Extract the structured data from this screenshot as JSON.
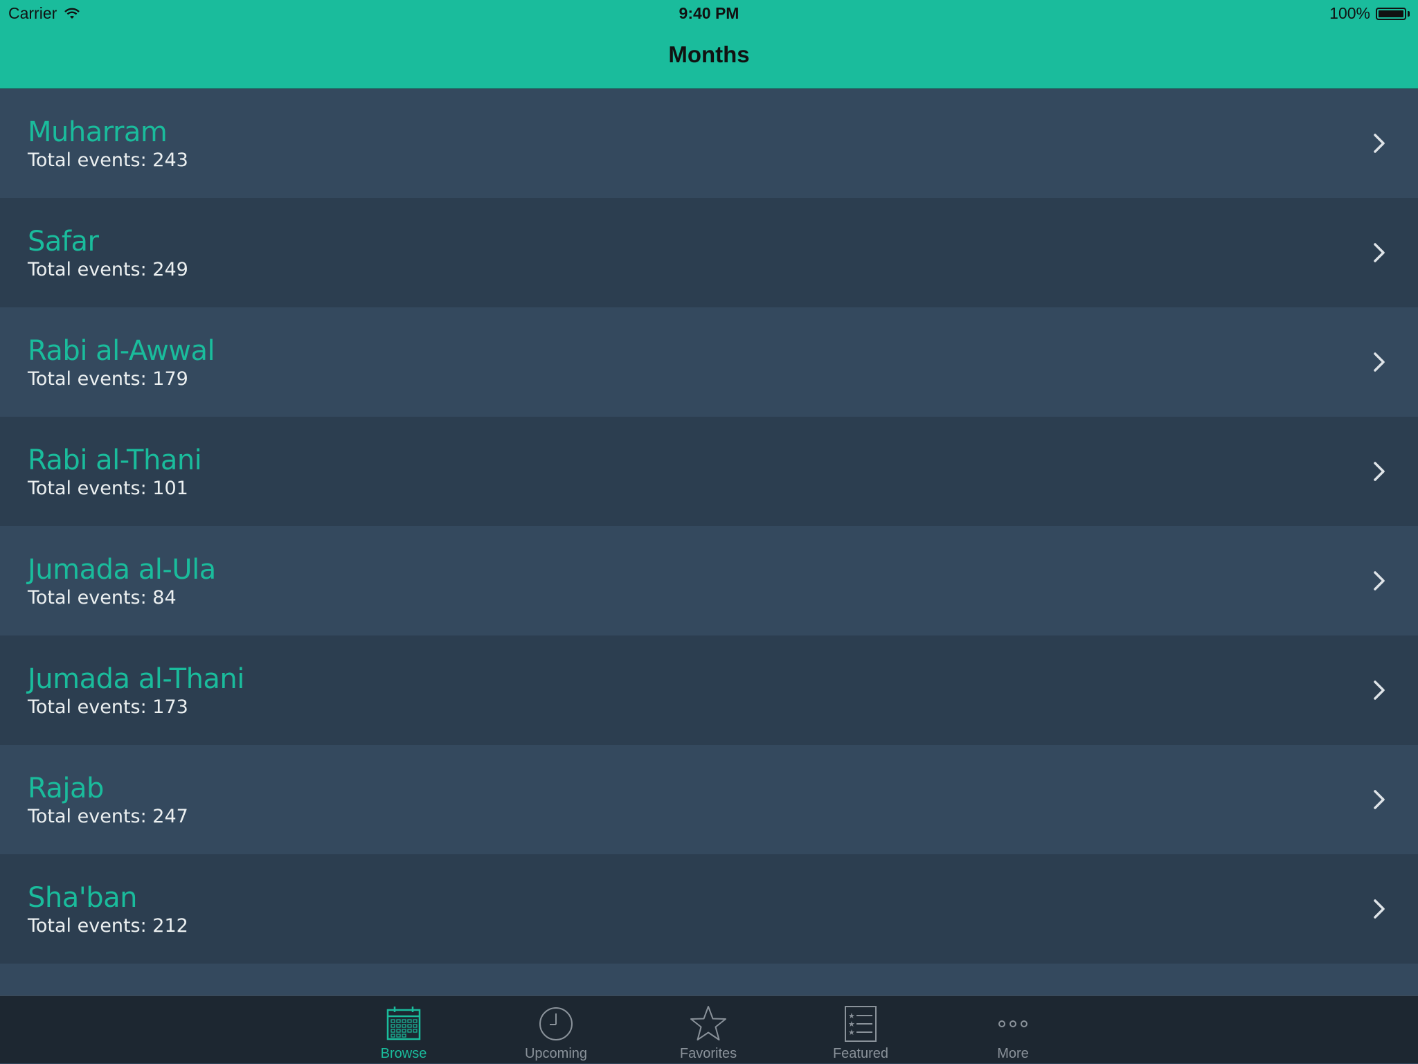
{
  "status_bar": {
    "carrier": "Carrier",
    "time": "9:40 PM",
    "battery": "100%",
    "battery_level": 1.0
  },
  "nav": {
    "title": "Months"
  },
  "months": [
    {
      "name": "Muharram",
      "count": "Total events: 243"
    },
    {
      "name": "Safar",
      "count": "Total events: 249"
    },
    {
      "name": "Rabi al-Awwal",
      "count": "Total events: 179"
    },
    {
      "name": "Rabi al-Thani",
      "count": "Total events: 101"
    },
    {
      "name": "Jumada al-Ula",
      "count": "Total events: 84"
    },
    {
      "name": "Jumada al-Thani",
      "count": "Total events: 173"
    },
    {
      "name": "Rajab",
      "count": "Total events: 247"
    },
    {
      "name": "Sha'ban",
      "count": "Total events: 212"
    }
  ],
  "tabs": [
    {
      "label": "Browse",
      "icon": "calendar-icon",
      "active": true
    },
    {
      "label": "Upcoming",
      "icon": "clock-icon",
      "active": false
    },
    {
      "label": "Favorites",
      "icon": "star-icon",
      "active": false
    },
    {
      "label": "Featured",
      "icon": "list-icon",
      "active": false
    },
    {
      "label": "More",
      "icon": "more-icon",
      "active": false
    }
  ],
  "colors": {
    "accent": "#1abc9c",
    "row_light": "#34495e",
    "row_dark": "#2c3e50",
    "tab_bar": "#1d2731"
  }
}
